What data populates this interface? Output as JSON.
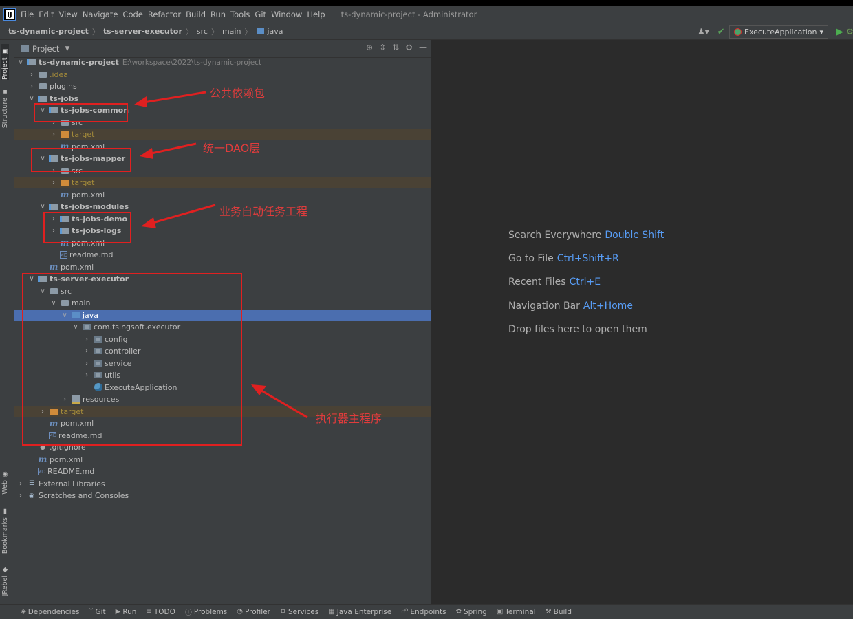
{
  "window": {
    "title": "ts-dynamic-project - Administrator"
  },
  "menu": [
    "File",
    "Edit",
    "View",
    "Navigate",
    "Code",
    "Refactor",
    "Build",
    "Run",
    "Tools",
    "Git",
    "Window",
    "Help"
  ],
  "breadcrumb": [
    "ts-dynamic-project",
    "ts-server-executor",
    "src",
    "main",
    "java"
  ],
  "run_config": {
    "label": "ExecuteApplication"
  },
  "left_tabs": [
    "Project",
    "Structure",
    "Web",
    "Bookmarks",
    "JRebel"
  ],
  "panel": {
    "title": "Project"
  },
  "tree": [
    {
      "label": "ts-dynamic-project",
      "path": "E:\\workspace\\2022\\ts-dynamic-project"
    },
    {
      "label": ".idea"
    },
    {
      "label": "plugins"
    },
    {
      "label": "ts-jobs"
    },
    {
      "label": "ts-jobs-common"
    },
    {
      "label": "src"
    },
    {
      "label": "target"
    },
    {
      "label": "pom.xml"
    },
    {
      "label": "ts-jobs-mapper"
    },
    {
      "label": "src"
    },
    {
      "label": "target"
    },
    {
      "label": "pom.xml"
    },
    {
      "label": "ts-jobs-modules"
    },
    {
      "label": "ts-jobs-demo"
    },
    {
      "label": "ts-jobs-logs"
    },
    {
      "label": "pom.xml"
    },
    {
      "label": "readme.md"
    },
    {
      "label": "pom.xml"
    },
    {
      "label": "ts-server-executor"
    },
    {
      "label": "src"
    },
    {
      "label": "main"
    },
    {
      "label": "java"
    },
    {
      "label": "com.tsingsoft.executor"
    },
    {
      "label": "config"
    },
    {
      "label": "controller"
    },
    {
      "label": "service"
    },
    {
      "label": "utils"
    },
    {
      "label": "ExecuteApplication"
    },
    {
      "label": "resources"
    },
    {
      "label": "target"
    },
    {
      "label": "pom.xml"
    },
    {
      "label": "readme.md"
    },
    {
      "label": ".gitignore"
    },
    {
      "label": "pom.xml"
    },
    {
      "label": "README.md"
    },
    {
      "label": "External Libraries"
    },
    {
      "label": "Scratches and Consoles"
    }
  ],
  "annotations": [
    "公共依赖包",
    "统一DAO层",
    "业务自动任务工程",
    "执行器主程序"
  ],
  "editor_hints": [
    {
      "text": "Search Everywhere",
      "key": "Double Shift"
    },
    {
      "text": "Go to File",
      "key": "Ctrl+Shift+R"
    },
    {
      "text": "Recent Files",
      "key": "Ctrl+E"
    },
    {
      "text": "Navigation Bar",
      "key": "Alt+Home"
    },
    {
      "text": "Drop files here to open them",
      "key": ""
    }
  ],
  "statusbar": [
    {
      "label": "Dependencies",
      "icon": "dependencies-icon"
    },
    {
      "label": "Git",
      "icon": "git-branch-icon"
    },
    {
      "label": "Run",
      "icon": "run-icon"
    },
    {
      "label": "TODO",
      "icon": "todo-icon"
    },
    {
      "label": "Problems",
      "icon": "problems-icon"
    },
    {
      "label": "Profiler",
      "icon": "profiler-icon"
    },
    {
      "label": "Services",
      "icon": "services-icon"
    },
    {
      "label": "Java Enterprise",
      "icon": "java-enterprise-icon"
    },
    {
      "label": "Endpoints",
      "icon": "endpoints-icon"
    },
    {
      "label": "Spring",
      "icon": "spring-icon"
    },
    {
      "label": "Terminal",
      "icon": "terminal-icon"
    },
    {
      "label": "Build",
      "icon": "build-icon"
    }
  ]
}
